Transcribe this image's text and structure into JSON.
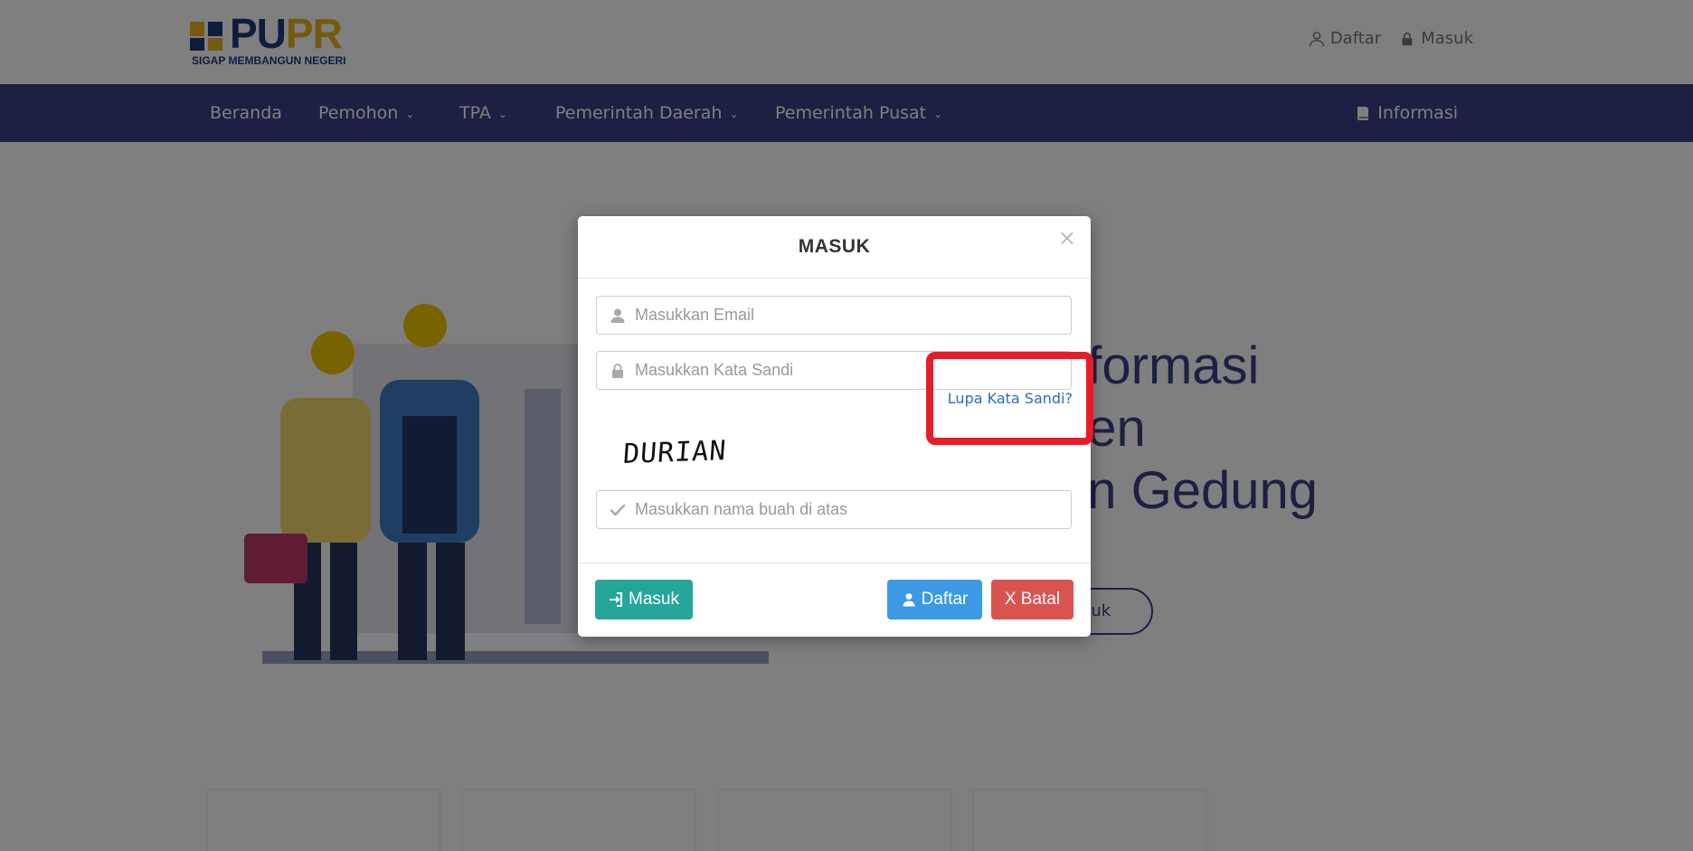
{
  "header": {
    "logo": {
      "word_pu": "PU",
      "word_pr": "PR",
      "tagline": "SIGAP MEMBANGUN NEGERI"
    },
    "top_links": [
      {
        "label": "Daftar",
        "icon": "user-icon"
      },
      {
        "label": "Masuk",
        "icon": "lock-icon"
      }
    ]
  },
  "nav": {
    "items": [
      {
        "label": "Beranda",
        "dropdown": false
      },
      {
        "label": "Pemohon",
        "dropdown": true
      },
      {
        "label": "TPA",
        "dropdown": true
      },
      {
        "label": "Pemerintah Daerah",
        "dropdown": true
      },
      {
        "label": "Pemerintah Pusat",
        "dropdown": true
      }
    ],
    "info_label": "Informasi",
    "info_icon": "book-icon"
  },
  "hero": {
    "title_lines": [
      "nformasi",
      "nen",
      "an Gedung"
    ],
    "button_label": "suk"
  },
  "modal": {
    "title": "MASUK",
    "close_label": "×",
    "email_placeholder": "Masukkan Email",
    "password_placeholder": "Masukkan Kata Sandi",
    "forgot_label": "Lupa Kata Sandi?",
    "captcha_text": "DURIAN",
    "captcha_placeholder": "Masukkan nama buah di atas",
    "buttons": {
      "login_label": "Masuk",
      "register_label": "Daftar",
      "cancel_label": "X Batal"
    }
  },
  "colors": {
    "nav_bg": "#3a3f86",
    "btn_login": "#26a69a",
    "btn_register": "#3b9ae1",
    "btn_cancel": "#d9534f",
    "highlight": "#e81c28",
    "link": "#2a6eb5"
  }
}
